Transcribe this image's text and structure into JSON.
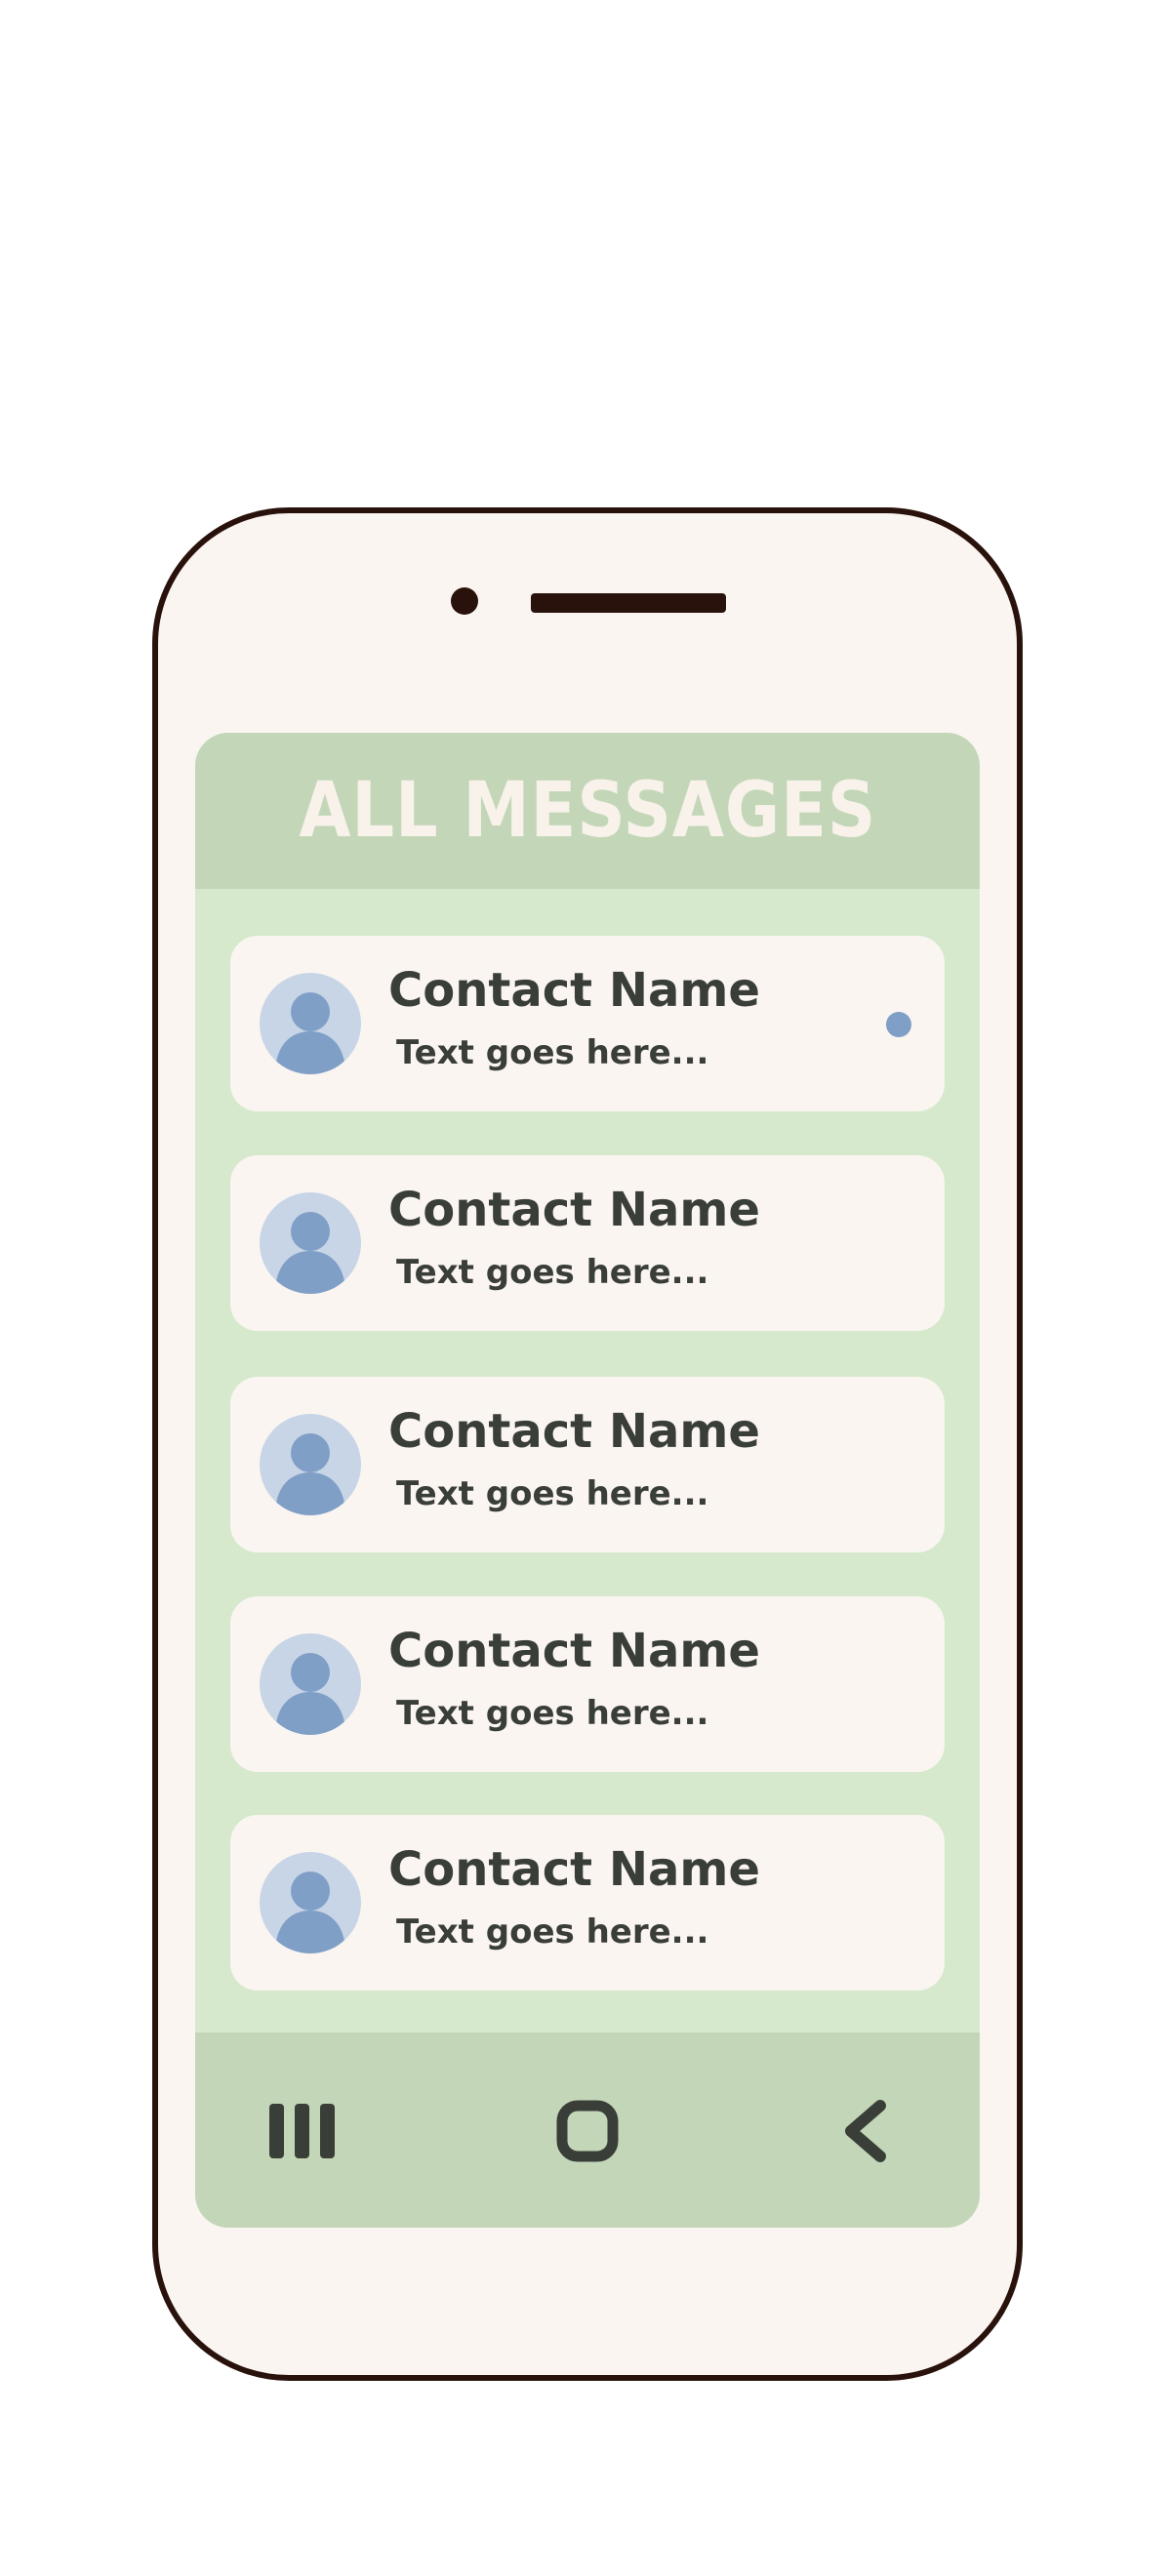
{
  "header": {
    "title": "ALL MESSAGES"
  },
  "messages": [
    {
      "name": "Contact Name",
      "preview": "Text goes here...",
      "unread": true
    },
    {
      "name": "Contact Name",
      "preview": "Text goes here...",
      "unread": false
    },
    {
      "name": "Contact Name",
      "preview": "Text goes here...",
      "unread": false
    },
    {
      "name": "Contact Name",
      "preview": "Text goes here...",
      "unread": false
    },
    {
      "name": "Contact Name",
      "preview": "Text goes here...",
      "unread": false
    }
  ],
  "navbar": {
    "recents_icon": "recents-icon",
    "home_icon": "home-icon",
    "back_icon": "back-icon"
  },
  "colors": {
    "header_bg": "#c3d7b8",
    "list_bg": "#d6e9cc",
    "card_bg": "#faf5f1",
    "avatar_bg": "#c8d5e6",
    "avatar_fg": "#7f9fc7",
    "text": "#3a3e38",
    "phone_frame": "#2a120c"
  }
}
